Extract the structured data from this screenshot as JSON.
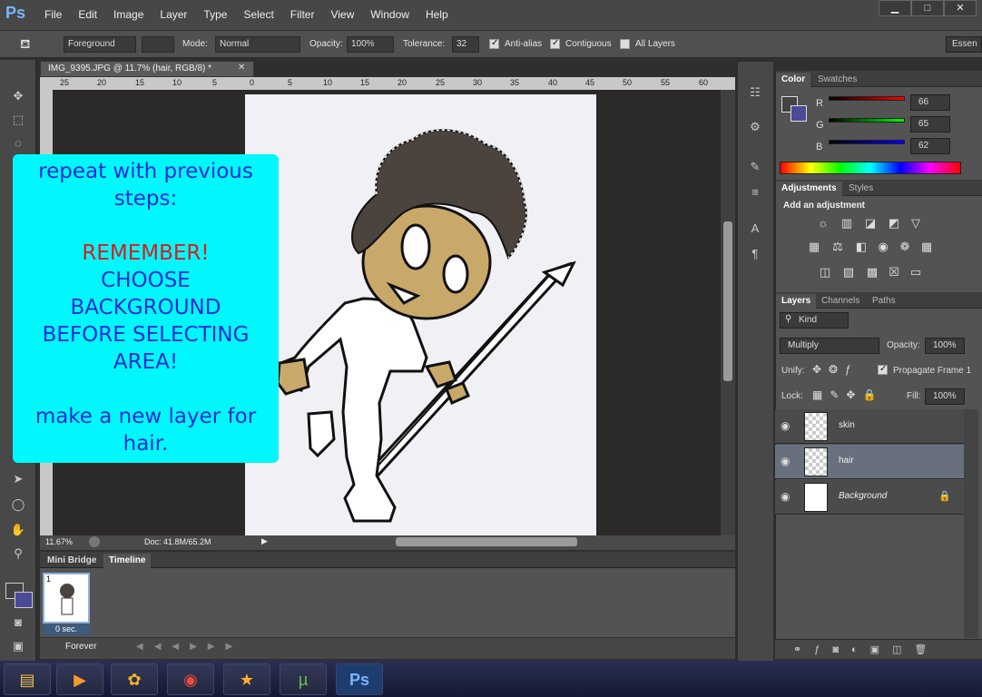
{
  "app": {
    "logo": "Ps"
  },
  "menu": [
    "File",
    "Edit",
    "Image",
    "Layer",
    "Type",
    "Select",
    "Filter",
    "View",
    "Window",
    "Help"
  ],
  "window_controls": [
    "▁",
    "□",
    "✕"
  ],
  "options": {
    "fill_source": "Foreground",
    "mode_label": "Mode:",
    "mode_value": "Normal",
    "opacity_label": "Opacity:",
    "opacity_value": "100%",
    "tolerance_label": "Tolerance:",
    "tolerance_value": "32",
    "antialias_label": "Anti-alias",
    "contiguous_label": "Contiguous",
    "alllayers_label": "All Layers",
    "workspace_label": "Essen"
  },
  "document": {
    "tab_title": "IMG_9395.JPG @ 11.7% (hair, RGB/8) *",
    "ruler_ticks": [
      "25",
      "20",
      "15",
      "10",
      "5",
      "0",
      "5",
      "10",
      "15",
      "20",
      "25",
      "30",
      "35",
      "40",
      "45",
      "50",
      "55",
      "60"
    ],
    "zoom": "11.67%",
    "doc_size": "Doc: 41.8M/65.2M"
  },
  "callout": {
    "line1": "repeat  with previous",
    "line2": "steps:",
    "line3": "REMEMBER!",
    "line4": "CHOOSE",
    "line5": "BACKGROUND",
    "line6": "BEFORE SELECTING",
    "line7": "AREA!",
    "line8": "make a new layer for",
    "line9": "hair.",
    "text_color": "#1a2bd8",
    "warn_color": "#d5201e",
    "bg_color": "#00f8fd"
  },
  "timeline": {
    "tabs": [
      "Mini Bridge",
      "Timeline"
    ],
    "frame_number": "1",
    "frame_duration": "0 sec.",
    "loop": "Forever"
  },
  "color_panel": {
    "tabs": [
      "Color",
      "Swatches"
    ],
    "r_label": "R",
    "r_value": "66",
    "g_label": "G",
    "g_value": "65",
    "b_label": "B",
    "b_value": "62"
  },
  "adjustments_panel": {
    "tabs": [
      "Adjustments",
      "Styles"
    ],
    "heading": "Add an adjustment"
  },
  "layers_panel": {
    "tabs": [
      "Layers",
      "Channels",
      "Paths"
    ],
    "filter_kind": "Kind",
    "blend_mode": "Multiply",
    "opacity_label": "Opacity:",
    "opacity_value": "100%",
    "unify_label": "Unify:",
    "propagate_label": "Propagate Frame 1",
    "lock_label": "Lock:",
    "fill_label": "Fill:",
    "fill_value": "100%",
    "layers": [
      {
        "name": "skin"
      },
      {
        "name": "hair"
      },
      {
        "name": "Background"
      }
    ]
  }
}
